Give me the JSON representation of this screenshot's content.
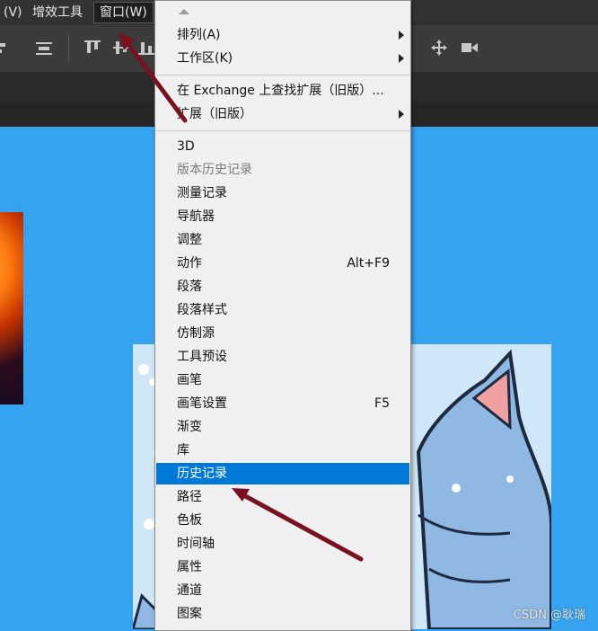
{
  "menubar": {
    "partial_item": "(V)",
    "plugins": "增效工具",
    "window": "窗口(W)"
  },
  "menu": {
    "sections": [
      [
        {
          "label": "排列(A)",
          "submenu": true
        },
        {
          "label": "工作区(K)",
          "submenu": true
        }
      ],
      [
        {
          "label": "在 Exchange 上查找扩展（旧版）..."
        },
        {
          "label": "扩展（旧版）",
          "submenu": true
        }
      ],
      [
        {
          "label": "3D"
        },
        {
          "label": "版本历史记录",
          "disabled": true
        },
        {
          "label": "测量记录"
        },
        {
          "label": "导航器"
        },
        {
          "label": "调整"
        },
        {
          "label": "动作",
          "shortcut": "Alt+F9"
        },
        {
          "label": "段落"
        },
        {
          "label": "段落样式"
        },
        {
          "label": "仿制源"
        },
        {
          "label": "工具预设"
        },
        {
          "label": "画笔"
        },
        {
          "label": "画笔设置",
          "shortcut": "F5"
        },
        {
          "label": "渐变"
        },
        {
          "label": "库"
        },
        {
          "label": "历史记录",
          "highlighted": true
        },
        {
          "label": "路径"
        },
        {
          "label": "色板"
        },
        {
          "label": "时间轴"
        },
        {
          "label": "属性"
        },
        {
          "label": "通道"
        },
        {
          "label": "图案"
        }
      ]
    ]
  },
  "watermark": "CSDN @耿瑞",
  "colors": {
    "canvas_bg": "#35a3f0",
    "menu_bg": "#f0f0f0",
    "highlight": "#0078d7",
    "annotation_arrow": "#7a1020"
  }
}
